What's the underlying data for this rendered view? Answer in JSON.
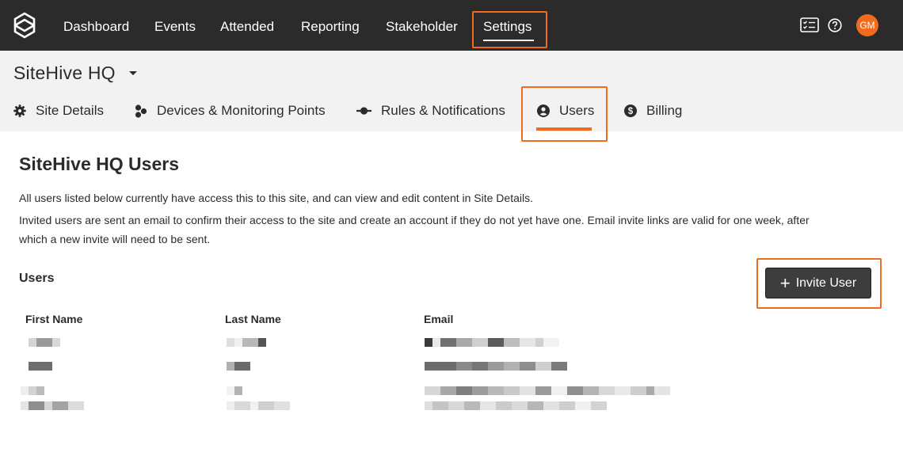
{
  "topbar": {
    "nav": [
      "Dashboard",
      "Events",
      "Attended",
      "Reporting",
      "Stakeholder",
      "Settings"
    ],
    "active": "Settings",
    "icons": [
      "checklist-icon",
      "help-icon"
    ],
    "avatar_initials": "GM"
  },
  "site": {
    "name": "SiteHive HQ"
  },
  "tabs": [
    {
      "label": "Site Details",
      "icon": "gear-icon"
    },
    {
      "label": "Devices & Monitoring Points",
      "icon": "devices-icon"
    },
    {
      "label": "Rules & Notifications",
      "icon": "rule-icon"
    },
    {
      "label": "Users",
      "icon": "user-circle-icon"
    },
    {
      "label": "Billing",
      "icon": "dollar-icon"
    }
  ],
  "page": {
    "title": "SiteHive HQ Users",
    "desc1": "All users listed below currently have access this to this site, and can view and edit content in Site Details.",
    "desc2": "Invited users are sent an email to confirm their access to the site and create an account if they do not yet have one. Email invite links are valid for one week, after",
    "desc3": "which a new invite will need to be sent.",
    "section_title": "Users",
    "invite_label": "Invite User"
  },
  "table": {
    "columns": [
      "First Name",
      "Last Name",
      "Email"
    ]
  },
  "colors": {
    "accent": "#f26b1d",
    "topbar": "#2b2b2b",
    "subheader": "#f2f2f2",
    "button": "#3d3d3d"
  }
}
